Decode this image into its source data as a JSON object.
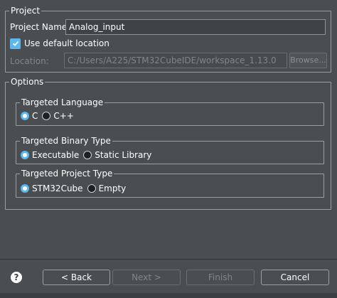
{
  "project_group": {
    "legend": "Project",
    "name_label": "Project Name:",
    "name_value": "Analog_input",
    "use_default_location_label": "Use default location",
    "location_label": "Location:",
    "location_value": "C:/Users/A225/STM32CubeIDE/workspace_1.13.0",
    "browse_label": "Browse..."
  },
  "options_group": {
    "legend": "Options",
    "targeted_language": {
      "legend": "Targeted Language",
      "options": [
        "C",
        "C++"
      ],
      "selected": "C"
    },
    "targeted_binary_type": {
      "legend": "Targeted Binary Type",
      "options": [
        "Executable",
        "Static Library"
      ],
      "selected": "Executable"
    },
    "targeted_project_type": {
      "legend": "Targeted Project Type",
      "options": [
        "STM32Cube",
        "Empty"
      ],
      "selected": "STM32Cube"
    }
  },
  "footer": {
    "help_glyph": "?",
    "back_label": "< Back",
    "next_label": "Next >",
    "finish_label": "Finish",
    "cancel_label": "Cancel"
  },
  "colors": {
    "background": "#4a4e51",
    "accent": "#5ab8ee",
    "disabled_text": "#7f868b"
  }
}
